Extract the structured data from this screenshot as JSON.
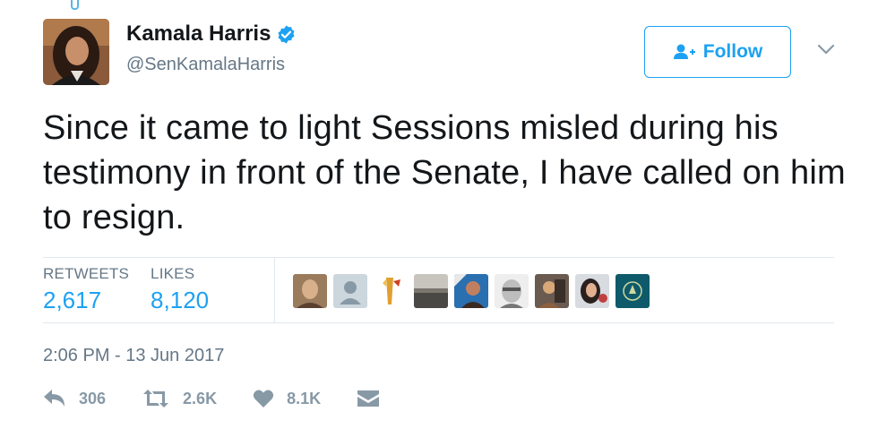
{
  "profile": {
    "name": "Kamala Harris",
    "handle": "@SenKamalaHarris",
    "follow_label": "Follow"
  },
  "tweet": {
    "text": "Since it came to light Sessions misled during his testimony in front of the Senate, I have called on him to resign.",
    "timestamp": "2:06 PM - 13 Jun 2017"
  },
  "stats": {
    "retweets_label": "RETWEETS",
    "retweets_value": "2,617",
    "likes_label": "LIKES",
    "likes_value": "8,120"
  },
  "actions": {
    "reply_count": "306",
    "retweet_count": "2.6K",
    "like_count": "8.1K"
  },
  "colors": {
    "accent": "#1da1f2",
    "secondary_text": "#657786",
    "action_gray": "#8899a6",
    "divider": "#e1e8ed"
  },
  "icons": [
    "verified-badge-icon",
    "follow-person-icon",
    "chevron-down-icon",
    "reply-icon",
    "retweet-icon",
    "heart-icon",
    "message-icon"
  ]
}
